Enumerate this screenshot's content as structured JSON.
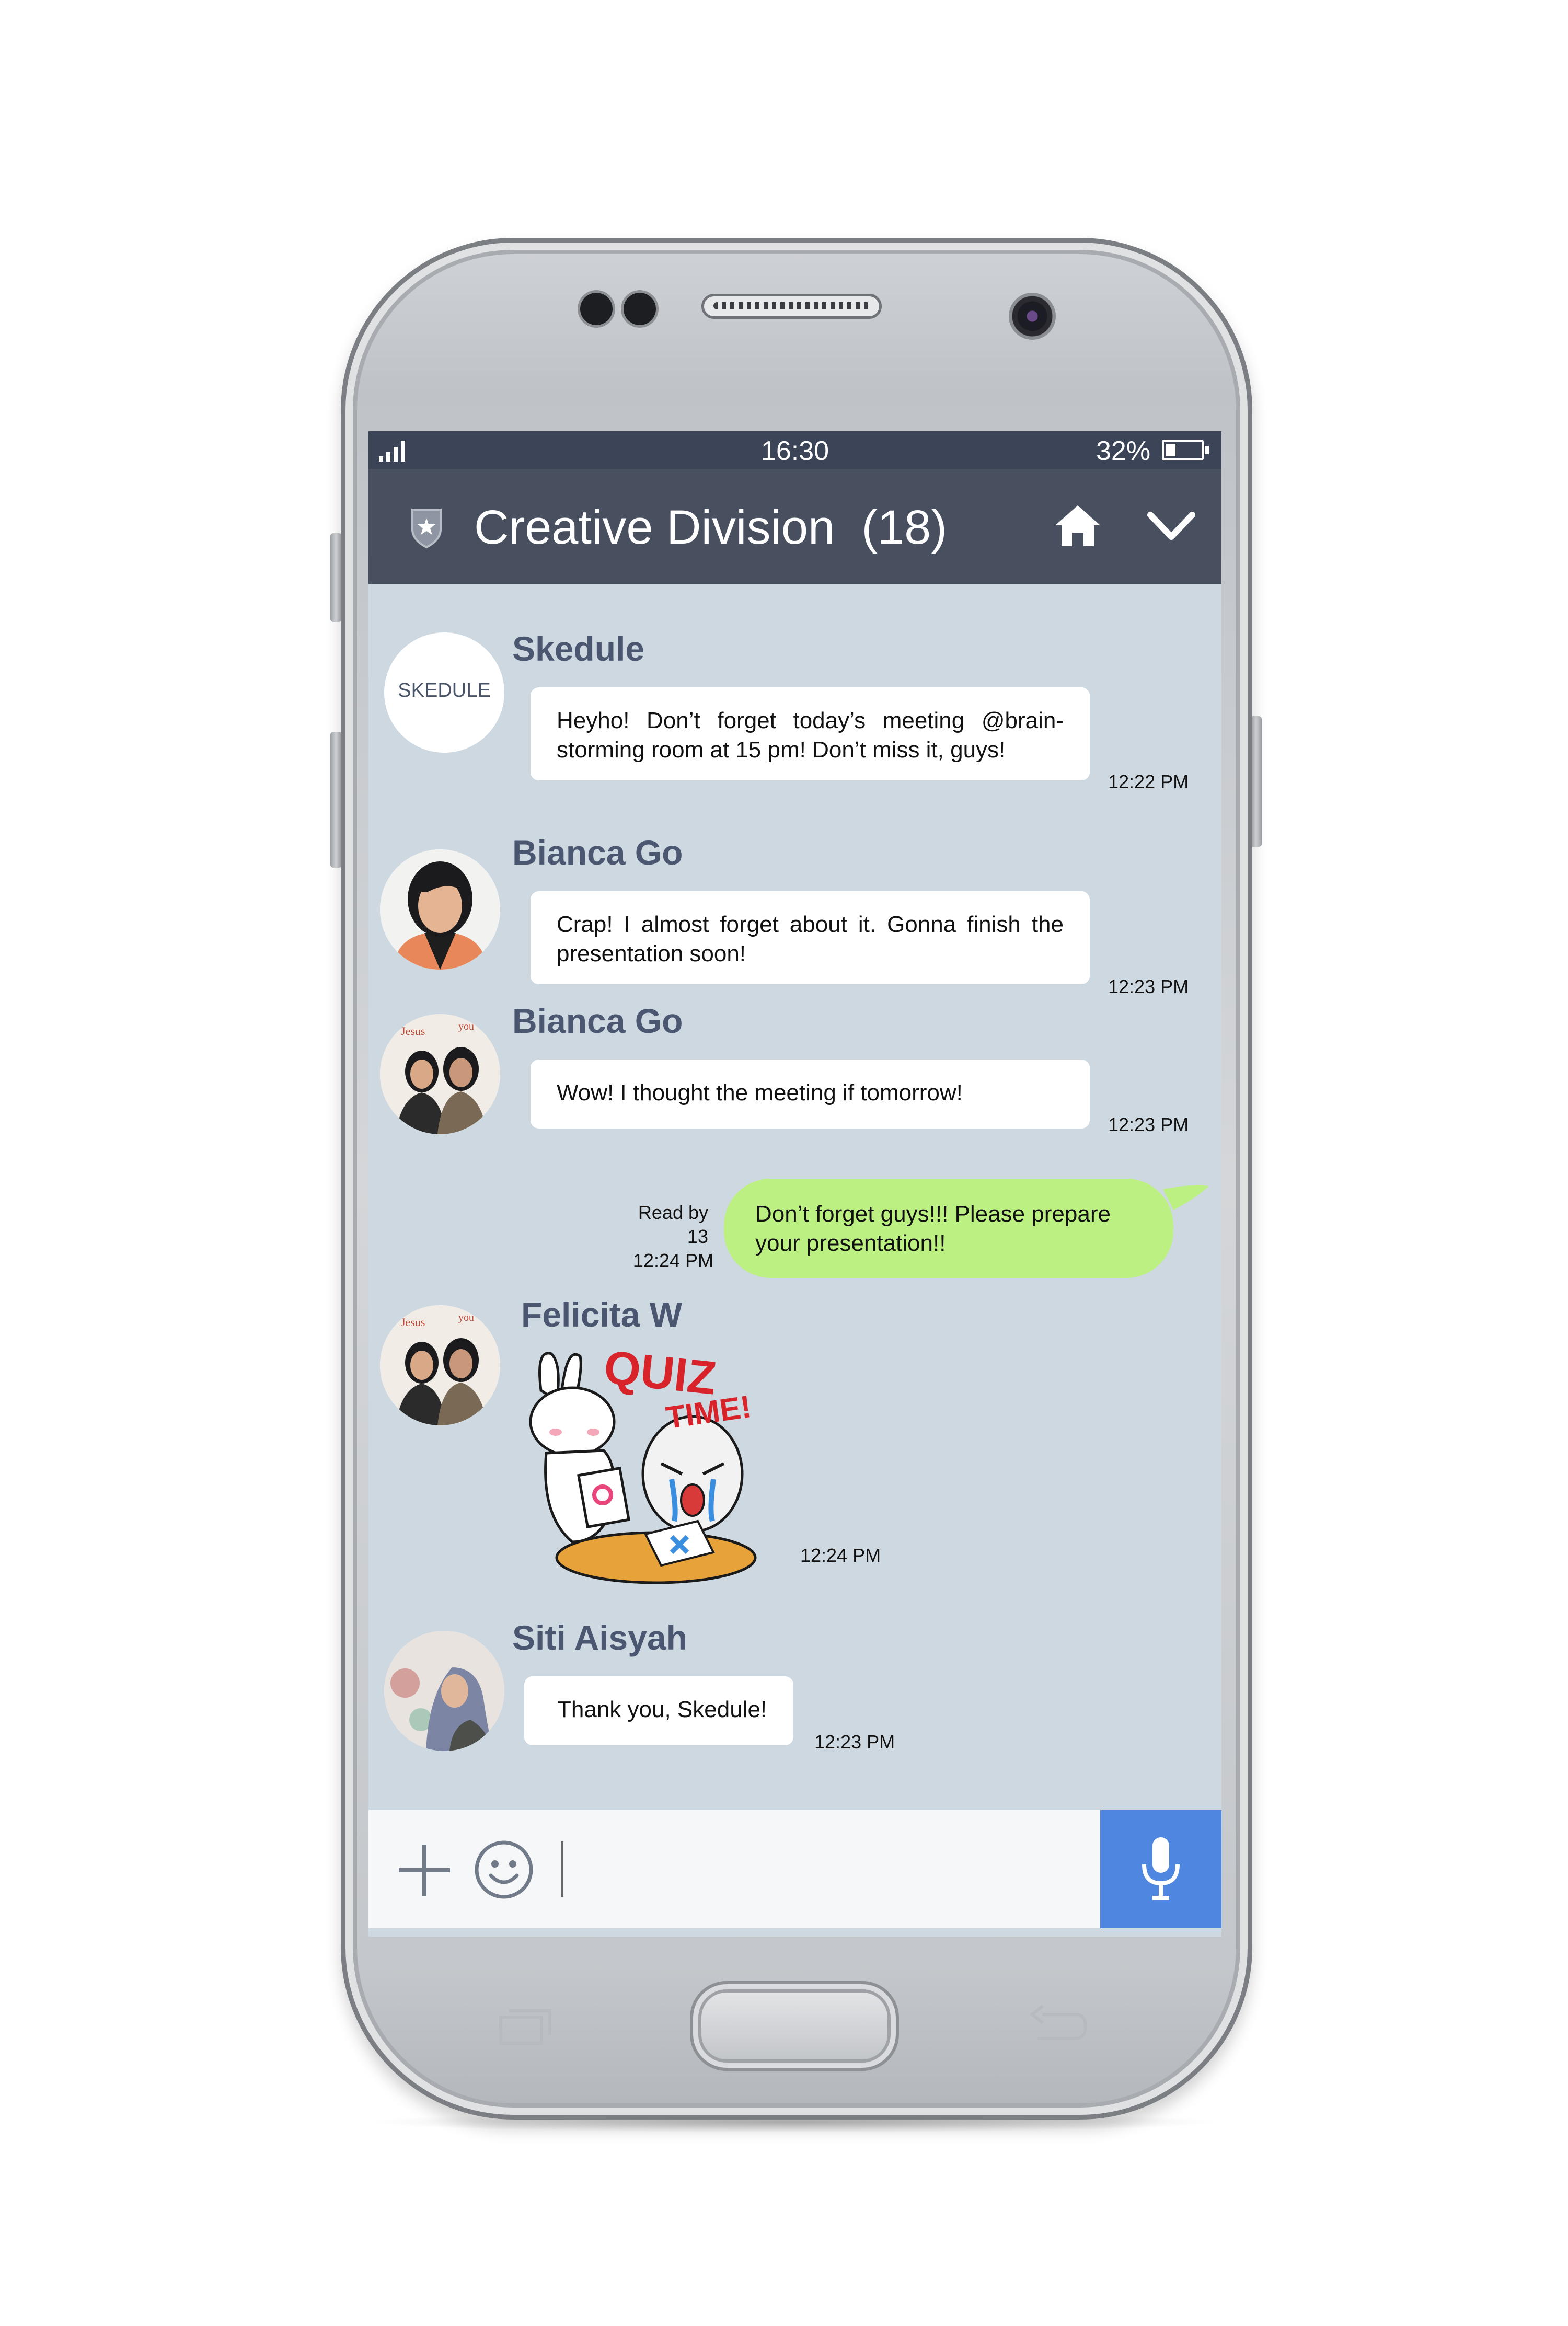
{
  "status_bar": {
    "time": "16:30",
    "battery_percent": "32%",
    "battery_level": 0.32,
    "icons": [
      "signal-icon",
      "battery-icon"
    ]
  },
  "header": {
    "title": "Creative Division",
    "member_count": "(18)",
    "icons": [
      "shield-icon",
      "home-icon",
      "chevron-down-icon"
    ]
  },
  "messages": [
    {
      "sender": "Skedule",
      "avatar_text": "SKEDULE",
      "text": "Heyho! Don’t forget today’s meeting @brain-storming room at 15 pm! Don’t miss it, guys!",
      "time": "12:22 PM"
    },
    {
      "sender": "Bianca Go",
      "text": "Crap! I almost forget about it. Gonna finish the presentation soon!",
      "time": "12:23 PM"
    },
    {
      "sender": "Bianca Go",
      "text": "Wow! I thought the meeting if tomorrow!",
      "time": "12:23 PM"
    },
    {
      "sender": "me",
      "text": "Don’t forget guys!!! Please prepare your presentation!!",
      "read_label": "Read by",
      "read_count": "13",
      "time": "12:24 PM"
    },
    {
      "sender": "Felicita W",
      "sticker_text_1": "QUIZ",
      "sticker_text_2": "TIME!",
      "time": "12:24 PM"
    },
    {
      "sender": "Siti Aisyah",
      "text": "Thank you, Skedule!",
      "time": "12:23 PM"
    }
  ],
  "input_bar": {
    "icons": [
      "plus-icon",
      "smiley-icon",
      "microphone-icon"
    ],
    "accent_color": "#4f86e0",
    "value": ""
  },
  "colors": {
    "header": "#48505f",
    "status_bar": "#3c4457",
    "chat_background": "#cdd8e1",
    "own_bubble": "#bdf082",
    "sender_name": "#4b5670"
  }
}
